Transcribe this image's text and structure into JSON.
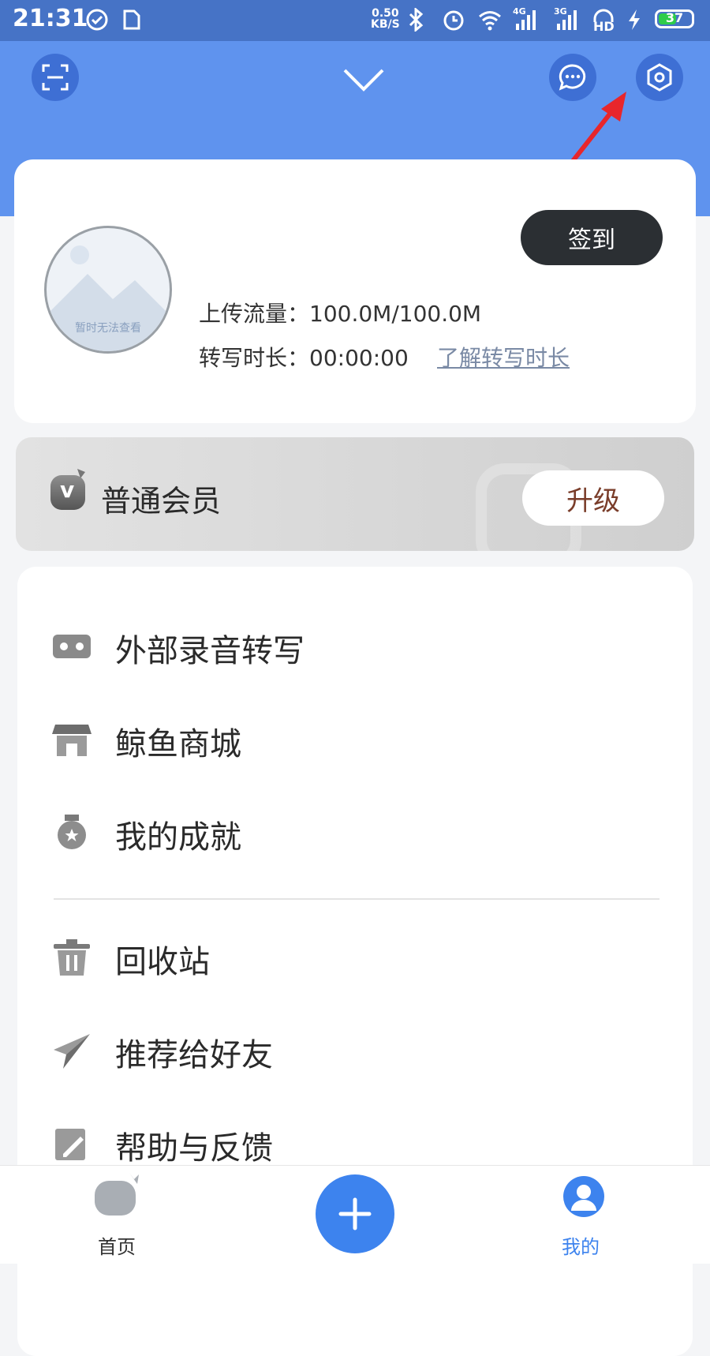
{
  "status_bar": {
    "time": "21:31",
    "net_speed_value": "0.50",
    "net_speed_unit": "KB/S",
    "signal1_label": "4G",
    "signal2_label": "3G",
    "hd_label": "HD",
    "battery_level": "37",
    "icons": [
      "check-circle-icon",
      "sim-card-icon",
      "bluetooth-icon",
      "alarm-icon",
      "wifi-icon",
      "signal-icon",
      "signal-icon",
      "headset-hd-icon",
      "charging-icon",
      "battery-icon"
    ]
  },
  "header": {
    "icons": [
      "scan-icon",
      "chevron-down-icon",
      "message-icon",
      "settings-icon"
    ]
  },
  "profile": {
    "avatar_placeholder": "暂时无法查看",
    "signin_label": "签到",
    "upload_label": "上传流量：",
    "upload_value": "100.0M/100.0M",
    "transcribe_label": "转写时长：",
    "transcribe_value": "00:00:00",
    "transcribe_link": "了解转写时长"
  },
  "membership": {
    "label": "普通会员",
    "upgrade_label": "升级",
    "badge_letter": "v"
  },
  "menu": {
    "items": [
      {
        "label": "外部录音转写",
        "icon": "recorder-icon"
      },
      {
        "label": "鲸鱼商城",
        "icon": "store-icon"
      },
      {
        "label": "我的成就",
        "icon": "medal-icon"
      },
      {
        "label": "回收站",
        "icon": "trash-icon"
      },
      {
        "label": "推荐给好友",
        "icon": "paper-plane-icon"
      },
      {
        "label": "帮助与反馈",
        "icon": "edit-icon"
      }
    ]
  },
  "bottom_nav": {
    "home_label": "首页",
    "add_icon": "plus-icon",
    "mine_label": "我的"
  },
  "colors": {
    "status_bar": "#4673c6",
    "header": "#5f93ee",
    "accent": "#3d83ee",
    "signin_bg": "#2b2f33",
    "upgrade_text": "#7a3d2a",
    "annotation_arrow": "#e8262b"
  }
}
